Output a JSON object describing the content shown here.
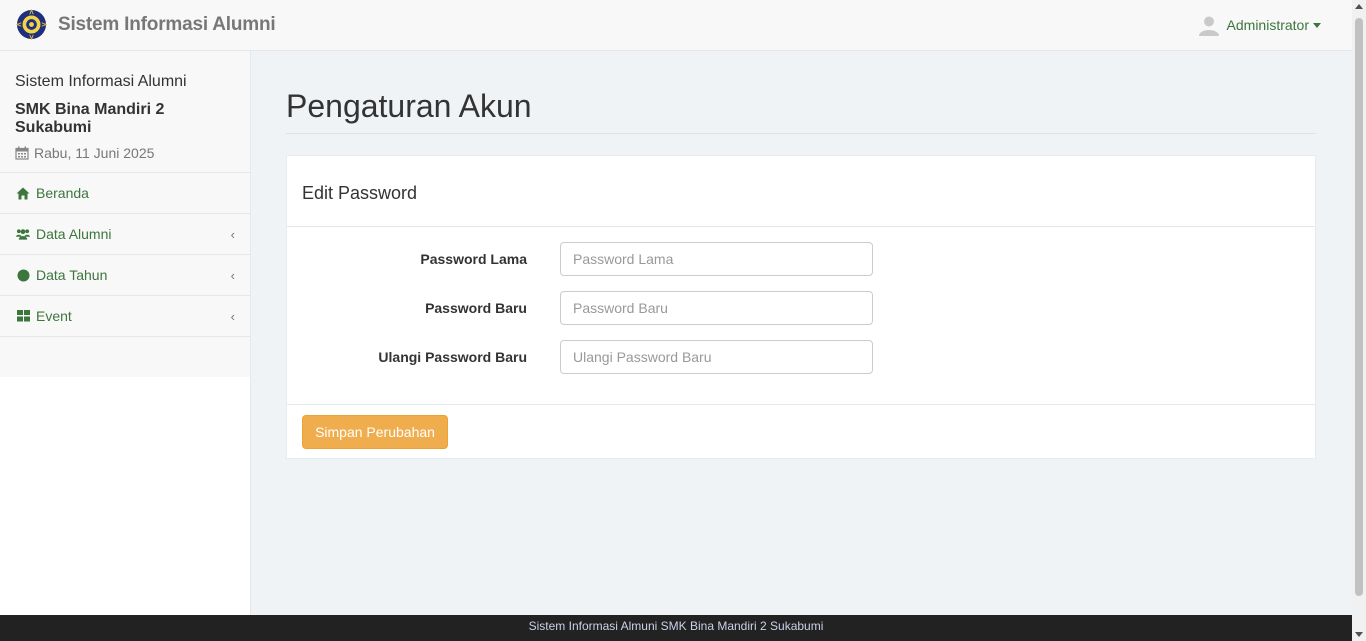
{
  "navbar": {
    "brand": "Sistem Informasi Alumni",
    "logo_icon": "school-emblem-icon",
    "user": "Administrator",
    "user_icon": "user-avatar-icon"
  },
  "sidebar": {
    "title": "Sistem Informasi Alumni",
    "school": "SMK Bina Mandiri 2 Sukabumi",
    "date": "Rabu, 11 Juni 2025",
    "items": [
      {
        "label": "Beranda",
        "icon": "home-icon"
      },
      {
        "label": "Data Alumni",
        "icon": "users-icon"
      },
      {
        "label": "Data Tahun",
        "icon": "circle-icon"
      },
      {
        "label": "Event",
        "icon": "grid-icon"
      }
    ]
  },
  "main": {
    "page_title": "Pengaturan Akun",
    "panel_title": "Edit Password",
    "fields": [
      {
        "label": "Password Lama",
        "placeholder": "Password Lama",
        "value": ""
      },
      {
        "label": "Password Baru",
        "placeholder": "Password Baru",
        "value": ""
      },
      {
        "label": "Ulangi Password Baru",
        "placeholder": "Ulangi Password Baru",
        "value": ""
      }
    ],
    "save_label": "Simpan Perubahan"
  },
  "footer": {
    "text": "Sistem Informasi Almuni SMK Bina Mandiri 2 Sukabumi"
  },
  "colors": {
    "accent_green": "#3c763d",
    "button_warning": "#f0ad4e",
    "footer_bg": "#222222"
  }
}
